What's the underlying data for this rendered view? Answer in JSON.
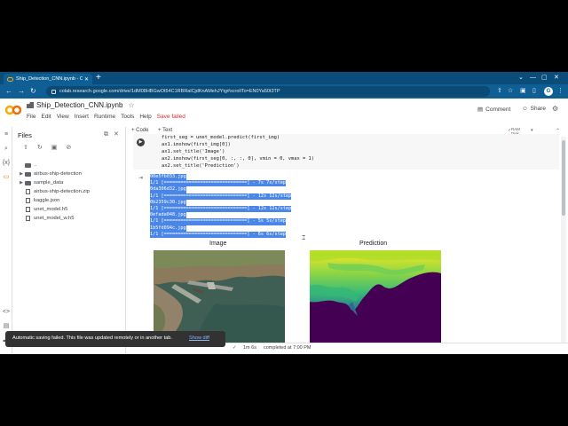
{
  "browser": {
    "tab_title": "Ship_Detection_CNN.ipynb - Colab",
    "tab_close": "✕",
    "new_tab": "+",
    "url": "colab.research.google.com/drive/1dM08HBGwOt54C1RBRalCjdKnAMehJYtg#scrollTo=EN0Ya50t3TP",
    "window_controls": [
      "⌄",
      "—",
      "▢",
      "✕"
    ],
    "nav": {
      "back": "←",
      "forward": "→",
      "reload": "↻"
    },
    "profile_initial": "G",
    "menu_icon": "⋮"
  },
  "colab": {
    "notebook_title": "Ship_Detection_CNN.ipynb",
    "star": "☆",
    "menu": [
      "File",
      "Edit",
      "View",
      "Insert",
      "Runtime",
      "Tools",
      "Help"
    ],
    "save_status": "Save failed",
    "comment_label": "Comment",
    "share_label": "Share",
    "settings_icon": "⚙"
  },
  "files": {
    "title": "Files",
    "items": [
      {
        "name": "..",
        "type": "parent"
      },
      {
        "name": "airbus-ship-detection",
        "type": "folder"
      },
      {
        "name": "sample_data",
        "type": "folder"
      },
      {
        "name": "airbus-ship-detection.zip",
        "type": "file"
      },
      {
        "name": "kaggle.json",
        "type": "file"
      },
      {
        "name": "unet_model.h5",
        "type": "file"
      },
      {
        "name": "unet_model_w.h5",
        "type": "file"
      }
    ]
  },
  "toolbar": {
    "add_code": "+ Code",
    "add_text": "+ Text",
    "ram": "RAM",
    "disk": "Disk"
  },
  "cell": {
    "code_lines": [
      "first_seg = unet_model.predict(first_img)",
      "ax1.imshow(first_img[0])",
      "ax1.set_title('Image')",
      "ax2.imshow(first_seg[0, :, :, 0], vmin = 0, vmax = 1)",
      "ax2.set_title('Prediction')"
    ],
    "output_lines": [
      "00e5fb033.jpg",
      "1/1 [==============================] - 7s 7s/step",
      "0da306d32.jpg",
      "1/1 [==============================] - 12s 12s/step",
      "0b2359c30.jpg",
      "1/1 [==============================] - 12s 12s/step",
      "0efada048.jpg",
      "1/1 [==============================] - 5s 5s/step",
      "1b5fd094c.jpg",
      "1/1 [==============================] - 6s 6s/step"
    ],
    "figure": {
      "left_title": "Image",
      "right_title": "Prediction"
    }
  },
  "status": {
    "check": "✓",
    "elapsed": "1m 6s",
    "completed": "completed at 7:00 PM"
  },
  "toast": {
    "message": "Automatic saving failed. This file was updated remotely or in another tab.",
    "action": "Show diff"
  },
  "colors": {
    "browser_bar": "#0b4d7a",
    "selection": "#4a86e8",
    "error": "#d93025",
    "prediction_low": "#440154",
    "prediction_high": "#fde725"
  }
}
